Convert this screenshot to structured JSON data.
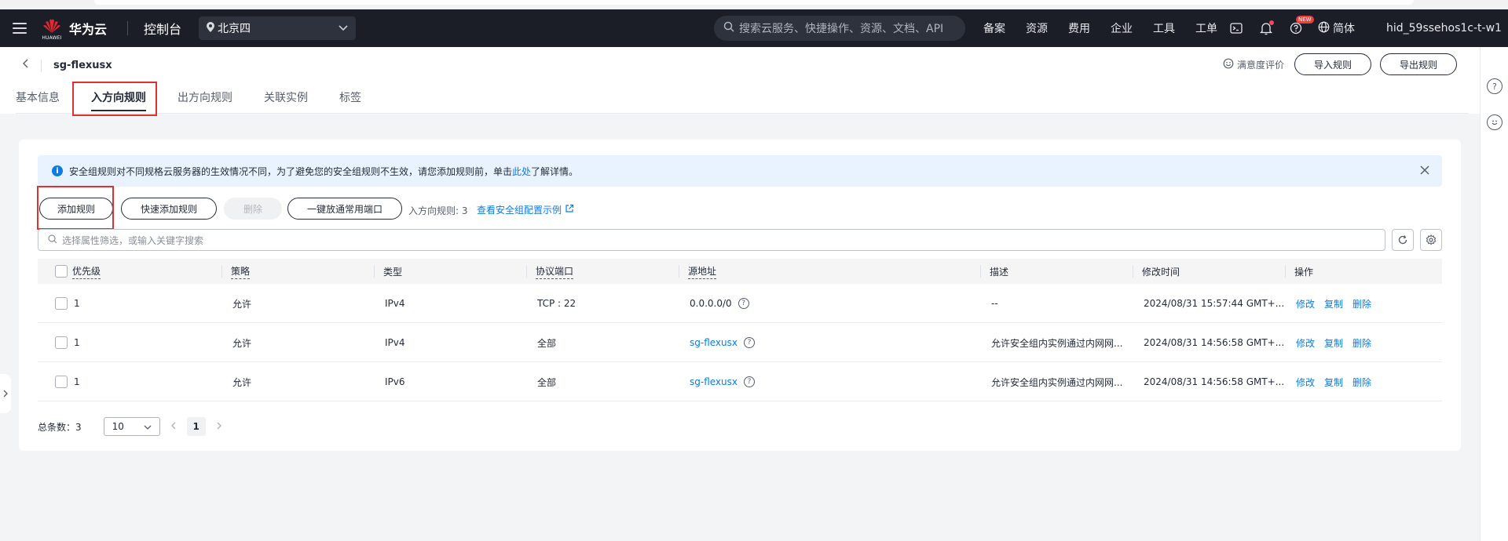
{
  "topbar": {
    "brand": "华为云",
    "brand_small": "HUAWEI",
    "console": "控制台",
    "region": "北京四",
    "search_placeholder": "搜索云服务、快捷操作、资源、文档、API",
    "links": [
      "备案",
      "资源",
      "费用",
      "企业",
      "工具",
      "工单"
    ],
    "new_badge": "NEW",
    "language": "简体",
    "user": "hid_59ssehos1c-t-w1"
  },
  "header": {
    "title": "sg-flexusx",
    "satisfaction": "满意度评价",
    "import_label": "导入规则",
    "export_label": "导出规则",
    "tabs": [
      {
        "label": "基本信息"
      },
      {
        "label": "入方向规则"
      },
      {
        "label": "出方向规则"
      },
      {
        "label": "关联实例"
      },
      {
        "label": "标签"
      }
    ]
  },
  "notice": {
    "text_before": "安全组规则对不同规格云服务器的生效情况不同，为了避免您的安全组规则不生效，请您添加规则前，单击",
    "link": "此处",
    "text_after": "了解详情。"
  },
  "toolbar": {
    "add_rule": "添加规则",
    "quick_add": "快速添加规则",
    "delete": "删除",
    "open_ports": "一键放通常用端口",
    "count_text": "入方向规则: 3",
    "example_link": "查看安全组配置示例"
  },
  "filter": {
    "placeholder": "选择属性筛选，或输入关键字搜索"
  },
  "table": {
    "headers": {
      "priority": "优先级",
      "policy": "策略",
      "type": "类型",
      "port": "协议端口",
      "source": "源地址",
      "desc": "描述",
      "time": "修改时间",
      "ops": "操作"
    },
    "rows": [
      {
        "priority": "1",
        "policy": "允许",
        "type": "IPv4",
        "port": "TCP : 22",
        "source": "0.0.0.0/0",
        "desc": "--",
        "time": "2024/08/31 15:57:44 GMT+..."
      },
      {
        "priority": "1",
        "policy": "允许",
        "type": "IPv4",
        "port": "全部",
        "source": "sg-flexusx",
        "desc": "允许安全组内实例通过内网网...",
        "time": "2024/08/31 14:56:58 GMT+..."
      },
      {
        "priority": "1",
        "policy": "允许",
        "type": "IPv6",
        "port": "全部",
        "source": "sg-flexusx",
        "desc": "允许安全组内实例通过内网网...",
        "time": "2024/08/31 14:56:58 GMT+..."
      }
    ],
    "ops": {
      "edit": "修改",
      "copy": "复制",
      "delete": "删除"
    }
  },
  "pager": {
    "total_label": "总条数：3",
    "page_size": "10",
    "current_page": "1"
  },
  "colors": {
    "topbar_bg": "#1b1e27",
    "link_blue": "#0d7be0",
    "highlight_red": "#e03131",
    "notice_bg": "#e8f3ff"
  }
}
